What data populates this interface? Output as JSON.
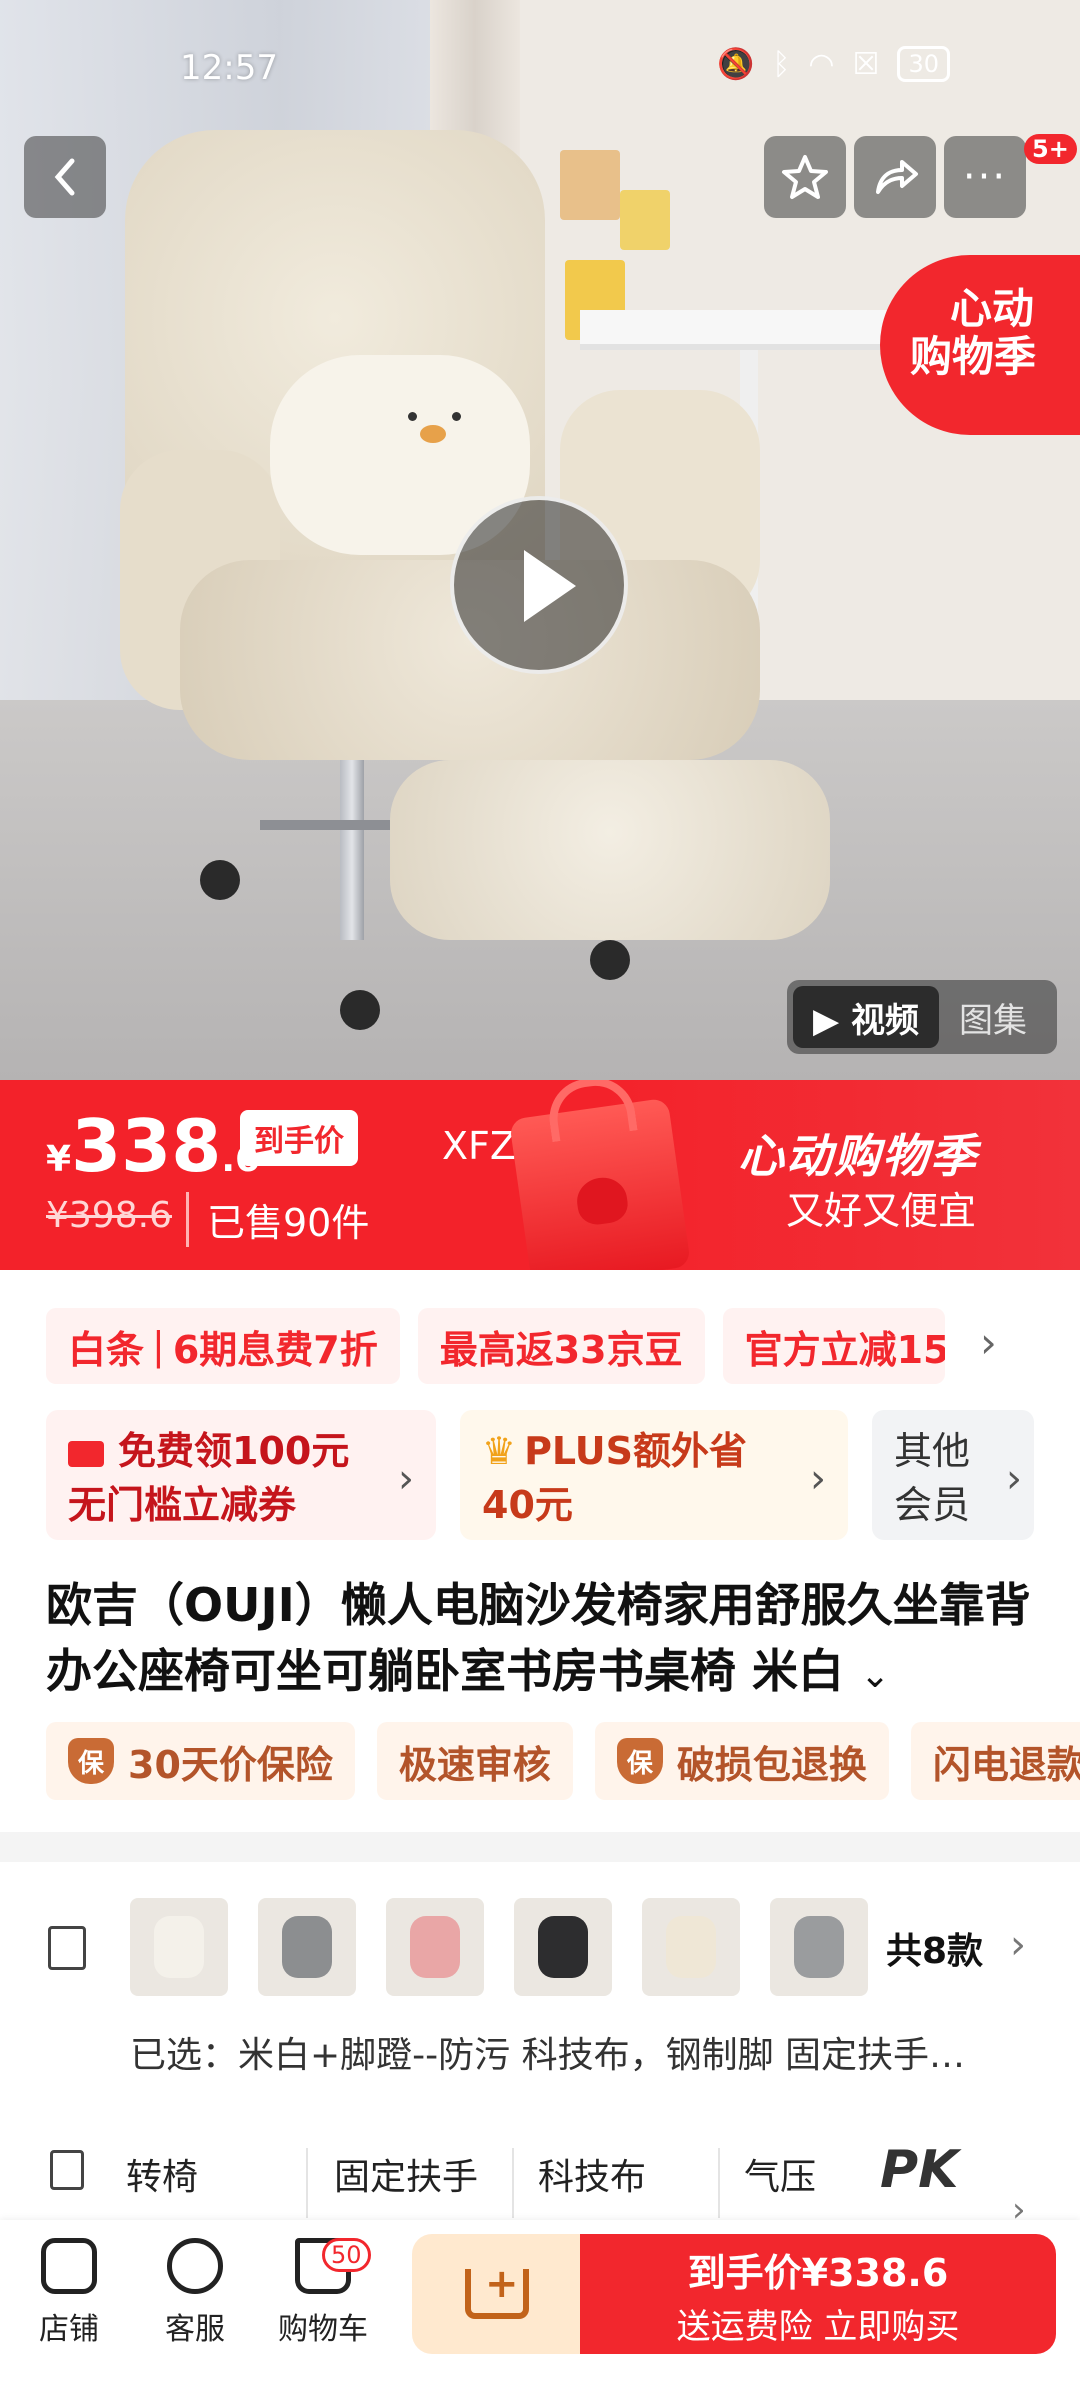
{
  "status_bar": {
    "time": "12:57",
    "battery": "30"
  },
  "hero": {
    "cart_badge": "5+",
    "promo_circle_line1": "心动",
    "promo_circle_line2": "购物季",
    "media_tabs": [
      {
        "label": "▶ 视频"
      },
      {
        "label": "图集"
      }
    ]
  },
  "price_banner": {
    "currency": "¥",
    "price_int": "338",
    "price_dec": ".6",
    "price_tag": "到手价",
    "coupon_code": "XFZ10",
    "original_price": "¥398.6",
    "sold": "已售90件",
    "festival_title": "心动购物季",
    "festival_sub": "又好又便宜"
  },
  "chips": [
    {
      "a": "白条",
      "b": "6期息费7折"
    },
    {
      "a": "最高返33京豆",
      "b": ""
    },
    {
      "a": "官方立减15",
      "b": ""
    }
  ],
  "cards": {
    "red": {
      "line1": "免费领100元",
      "line2": "无门槛立减券"
    },
    "gold": {
      "line1": "PLUS额外省",
      "line2": "40元"
    },
    "gray": {
      "line1": "其他",
      "line2": "会员"
    }
  },
  "product": {
    "title": "欧吉（OUJI）懒人电脑沙发椅家用舒服久坐靠背办公座椅可坐可躺卧室书房书桌椅 米白"
  },
  "services": [
    {
      "label": "30天价保险",
      "icon": true
    },
    {
      "label": "极速审核",
      "icon": false
    },
    {
      "label": "破损包退换",
      "icon": true
    },
    {
      "label": "闪电退款",
      "icon": false
    }
  ],
  "services_icon_text": "保",
  "variants": {
    "count": "共8款",
    "selected": "已选：米白+脚蹬--防污 科技布，钢制脚 固定扶手…"
  },
  "params": [
    "转椅",
    "固定扶手",
    "科技布",
    "气压"
  ],
  "params_pk": "PK",
  "bottom_bar": {
    "shop": "店铺",
    "service": "客服",
    "cart": "购物车",
    "cart_count": "50",
    "buy_line1": "到手价¥338.6",
    "buy_line2": "送运费险 立即购买"
  }
}
